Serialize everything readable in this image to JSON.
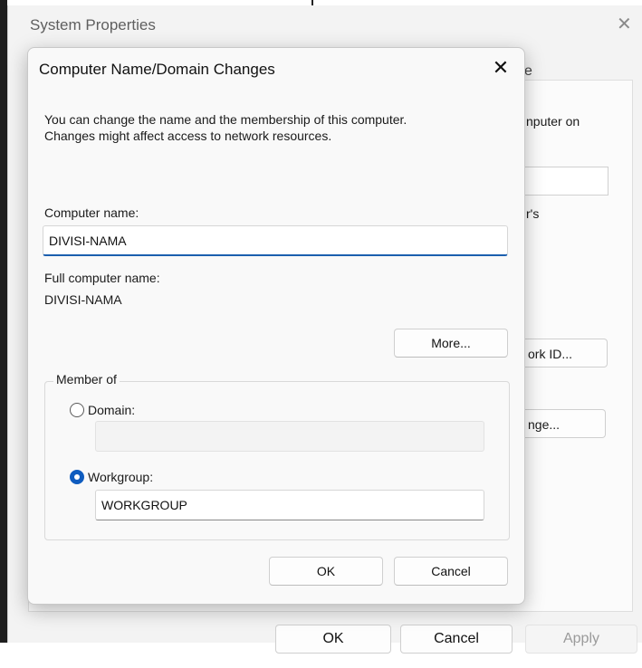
{
  "background_window": {
    "title": "System Properties",
    "close_glyph": "✕",
    "tab_fragment": "e",
    "text_fragment_1": "nputer on",
    "text_fragment_2": "r's",
    "network_id_fragment": "ork ID...",
    "change_fragment": "nge...",
    "ok_label": "OK",
    "cancel_label": "Cancel",
    "apply_label": "Apply"
  },
  "dialog": {
    "title": "Computer Name/Domain Changes",
    "close_glyph": "✕",
    "description_line1": "You can change the name and the membership of this computer.",
    "description_line2": "Changes might affect access to network resources.",
    "computer_name_label": "Computer name:",
    "computer_name_value": "DIVISI-NAMA",
    "full_name_label": "Full computer name:",
    "full_name_value": "DIVISI-NAMA",
    "more_label": "More...",
    "member_of_label": "Member of",
    "domain_label": "Domain:",
    "domain_value": "",
    "domain_selected": false,
    "workgroup_label": "Workgroup:",
    "workgroup_value": "WORKGROUP",
    "workgroup_selected": true,
    "ok_label": "OK",
    "cancel_label": "Cancel"
  },
  "colors": {
    "accent": "#0f5cbf",
    "focus_underline": "#1b5fae"
  }
}
